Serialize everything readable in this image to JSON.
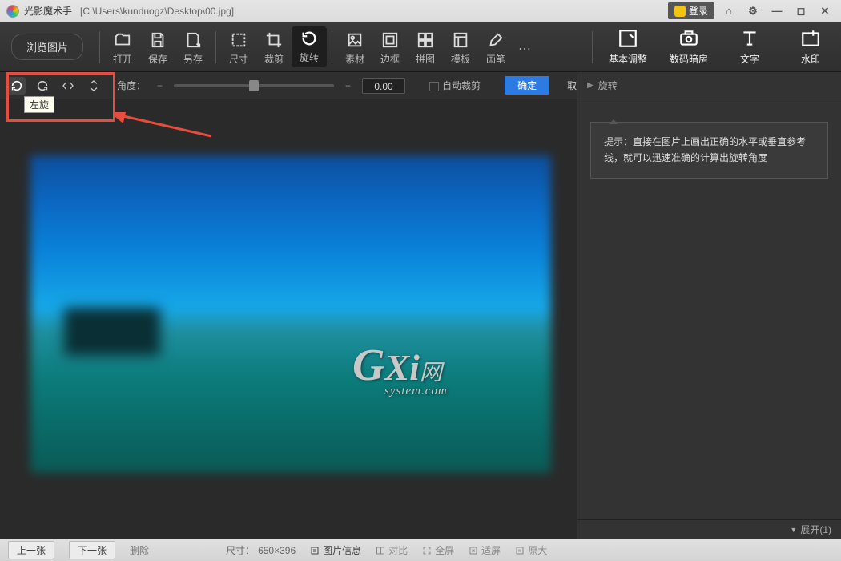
{
  "title": {
    "app": "光影魔术手",
    "path": "[C:\\Users\\kunduogz\\Desktop\\00.jpg]",
    "login": "登录"
  },
  "toolbar": {
    "browse": "浏览图片",
    "items": [
      {
        "label": "打开",
        "icon": "open"
      },
      {
        "label": "保存",
        "icon": "save"
      },
      {
        "label": "另存",
        "icon": "saveas"
      },
      {
        "label": "尺寸",
        "icon": "size"
      },
      {
        "label": "裁剪",
        "icon": "crop"
      },
      {
        "label": "旋转",
        "icon": "rotate",
        "active": true
      },
      {
        "label": "素材",
        "icon": "material"
      },
      {
        "label": "边框",
        "icon": "border"
      },
      {
        "label": "拼图",
        "icon": "collage"
      },
      {
        "label": "模板",
        "icon": "template"
      },
      {
        "label": "画笔",
        "icon": "brush"
      }
    ],
    "right": [
      {
        "label": "基本调整",
        "icon": "adjust"
      },
      {
        "label": "数码暗房",
        "icon": "darkroom"
      },
      {
        "label": "文字",
        "icon": "text"
      },
      {
        "label": "水印",
        "icon": "watermark"
      }
    ]
  },
  "rotate": {
    "tooltip": "左旋",
    "angle_label": "角度：",
    "angle_value": "0.00",
    "autocrop": "自动裁剪",
    "confirm": "确定",
    "cancel": "取消"
  },
  "side": {
    "title": "旋转",
    "hint": "提示：直接在图片上画出正确的水平或垂直参考线，就可以迅速准确的计算出旋转角度",
    "expand": "展开(1)"
  },
  "status": {
    "prev": "上一张",
    "next": "下一张",
    "delete": "删除",
    "size_label": "尺寸：",
    "size_value": "650×396",
    "info": "图片信息",
    "compare": "对比",
    "fullscreen": "全屏",
    "fit": "适屏",
    "original": "原大"
  },
  "watermark": {
    "g": "G",
    "xi": "Xi",
    "net": "网",
    "sys": "system.com"
  }
}
